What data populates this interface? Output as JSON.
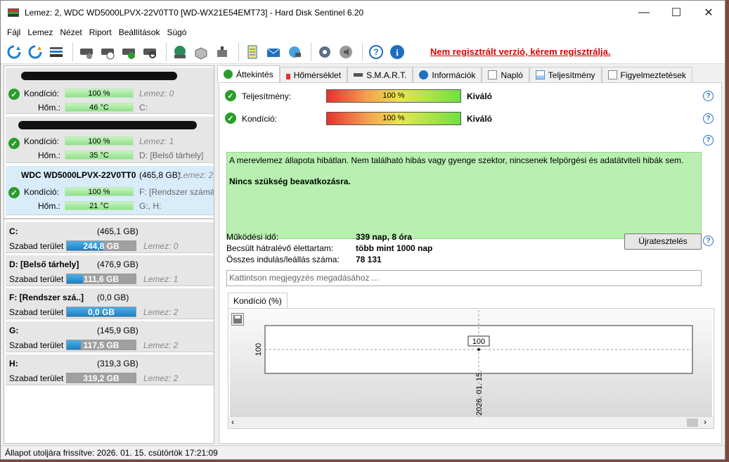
{
  "title": "Lemez: 2, WDC WD5000LPVX-22V0TT0 [WD-WX21E54EMT73]  -  Hard Disk Sentinel 6.20",
  "window_buttons": {
    "minimize": "—",
    "maximize": "☐",
    "close": "✕"
  },
  "menu": [
    "Fájl",
    "Lemez",
    "Nézet",
    "Riport",
    "Beállítások",
    "Súgó"
  ],
  "toolbar": {
    "icons": [
      "refresh-icon",
      "refresh-all-icon",
      "disk-info-icon",
      "disk-status-icon",
      "disk-schedule-icon",
      "disk-ok-icon",
      "disk-search-icon",
      "network-disk-icon",
      "hdd-icon",
      "usb-disk-icon",
      "notepad-icon",
      "email-icon",
      "network-icon",
      "settings-icon",
      "sound-icon",
      "help-icon",
      "info-icon"
    ],
    "register_link": "Nem regisztrált verzió, kérem regisztrálja."
  },
  "disks": [
    {
      "name": "",
      "condition_label": "Kondíció:",
      "condition": "100 %",
      "disk_index": "Lemez: 0",
      "temp_label": "Hőm.:",
      "temp": "46 °C",
      "volumes": "C:"
    },
    {
      "name": "",
      "condition_label": "Kondíció:",
      "condition": "100 %",
      "disk_index": "Lemez: 1",
      "temp_label": "Hőm.:",
      "temp": "35 °C",
      "volumes": "D: [Belső tárhely]"
    },
    {
      "name": "WDC WD5000LPVX-22V0TT0",
      "size": "(465,8 GB)",
      "disk_index": "Lemez: 2",
      "condition_label": "Kondíció:",
      "condition": "100 %",
      "temp_label": "Hőm.:",
      "temp": "21 °C",
      "volumes": "F: [Rendszer számára",
      "volumes2": "G:, H:"
    }
  ],
  "volumes": [
    {
      "name": "C:",
      "size": "(465,1 GB)",
      "free_label": "Szabad terület",
      "free": "244,8 GB",
      "free_fraction": 0.53,
      "disk": "Lemez: 0"
    },
    {
      "name": "D: [Belső tárhely]",
      "size": "(476,9 GB)",
      "free_label": "Szabad terület",
      "free": "111,6 GB",
      "free_fraction": 0.23,
      "disk": "Lemez: 1"
    },
    {
      "name": "F: [Rendszer szá..]",
      "size": "(0,0 GB)",
      "free_label": "Szabad terület",
      "free": "0,0 GB",
      "free_fraction": 1.0,
      "disk": "Lemez: 2"
    },
    {
      "name": "G:",
      "size": "(145,9 GB)",
      "free_label": "Szabad terület",
      "free": "117,5 GB",
      "free_fraction": 0.2,
      "disk": "Lemez: 2"
    },
    {
      "name": "H:",
      "size": "(319,3 GB)",
      "free_label": "Szabad terület",
      "free": "319,2 GB",
      "free_fraction": 0.0,
      "disk": "Lemez: 2"
    }
  ],
  "tabs": [
    "Áttekintés",
    "Hőmérséklet",
    "S.M.A.R.T.",
    "Információk",
    "Napló",
    "Teljesítmény",
    "Figyelmeztetések"
  ],
  "overview": {
    "performance_label": "Teljesítmény:",
    "performance_value": "100 %",
    "performance_rating": "Kiváló",
    "condition_label": "Kondíció:",
    "condition_value": "100 %",
    "condition_rating": "Kiváló",
    "status_text": "A merevlemez állapota hibátlan. Nem található hibás vagy gyenge szektor, nincsenek felpörgési és adatátviteli hibák sem.",
    "action_text": "Nincs szükség beavatkozásra.",
    "uptime_label": "Működési idő:",
    "uptime_value": "339 nap, 8 óra",
    "lifetime_label": "Becsült hátralévő élettartam:",
    "lifetime_value": "több mint 1000 nap",
    "startstop_label": "Összes indulás/leállás száma:",
    "startstop_value": "78 131",
    "retest_button": "Újratesztelés",
    "note_placeholder": "Kattintson megjegyzés megadásához ...",
    "chart_tab": "Kondíció  (%)"
  },
  "chart_data": {
    "type": "line",
    "x": [
      "2026. 01. 15."
    ],
    "values": [
      100
    ],
    "ytick": "100",
    "point_label": "100"
  },
  "status_bar": "Állapot utoljára frissítve: 2026. 01. 15. csütörtök 17:21:09"
}
